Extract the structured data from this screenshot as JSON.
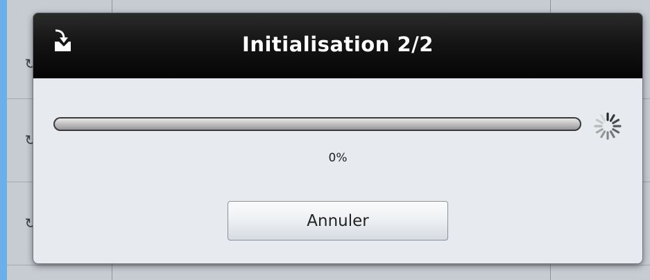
{
  "dialog": {
    "title": "Initialisation 2/2",
    "title_icon": "download-tray-icon",
    "progress": {
      "percent_label": "0%",
      "value": 0
    },
    "spinner_icon": "loading-spinner-icon",
    "cancel_label": "Annuler"
  },
  "colors": {
    "desktop_background": "#6aaeea",
    "titlebar": "#111111",
    "title_text": "#ffffff",
    "dialog_body": "#e7ebef",
    "progress_fill": "#2f7de0"
  }
}
